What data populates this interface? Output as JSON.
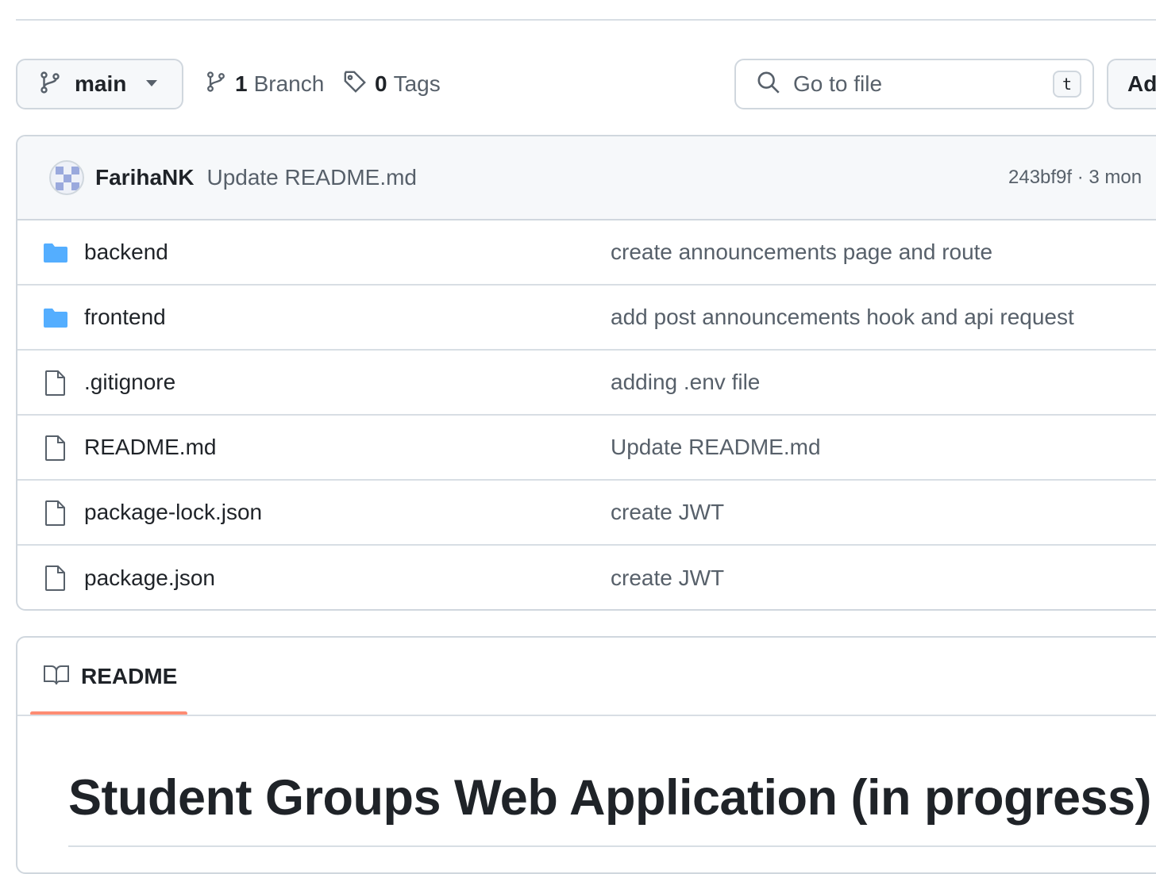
{
  "toolbar": {
    "branch": "main",
    "branches_count": "1",
    "branches_label": "Branch",
    "tags_count": "0",
    "tags_label": "Tags",
    "goto_placeholder": "Go to file",
    "goto_shortcut": "t",
    "add_label": "Ad"
  },
  "latest_commit": {
    "author": "FarihaNK",
    "message": "Update README.md",
    "meta": "243bf9f · 3 mon"
  },
  "files": [
    {
      "name": "backend",
      "type": "folder",
      "message": "create announcements page and route"
    },
    {
      "name": "frontend",
      "type": "folder",
      "message": "add post announcements hook and api request"
    },
    {
      "name": ".gitignore",
      "type": "file",
      "message": "adding .env file"
    },
    {
      "name": "README.md",
      "type": "file",
      "message": "Update README.md"
    },
    {
      "name": "package-lock.json",
      "type": "file",
      "message": "create JWT"
    },
    {
      "name": "package.json",
      "type": "file",
      "message": "create JWT"
    }
  ],
  "readme": {
    "tab_label": "README",
    "title": "Student Groups Web Application (in progress)"
  },
  "colors": {
    "folder_icon": "#54aeff",
    "tab_underline": "#fd8c73"
  }
}
